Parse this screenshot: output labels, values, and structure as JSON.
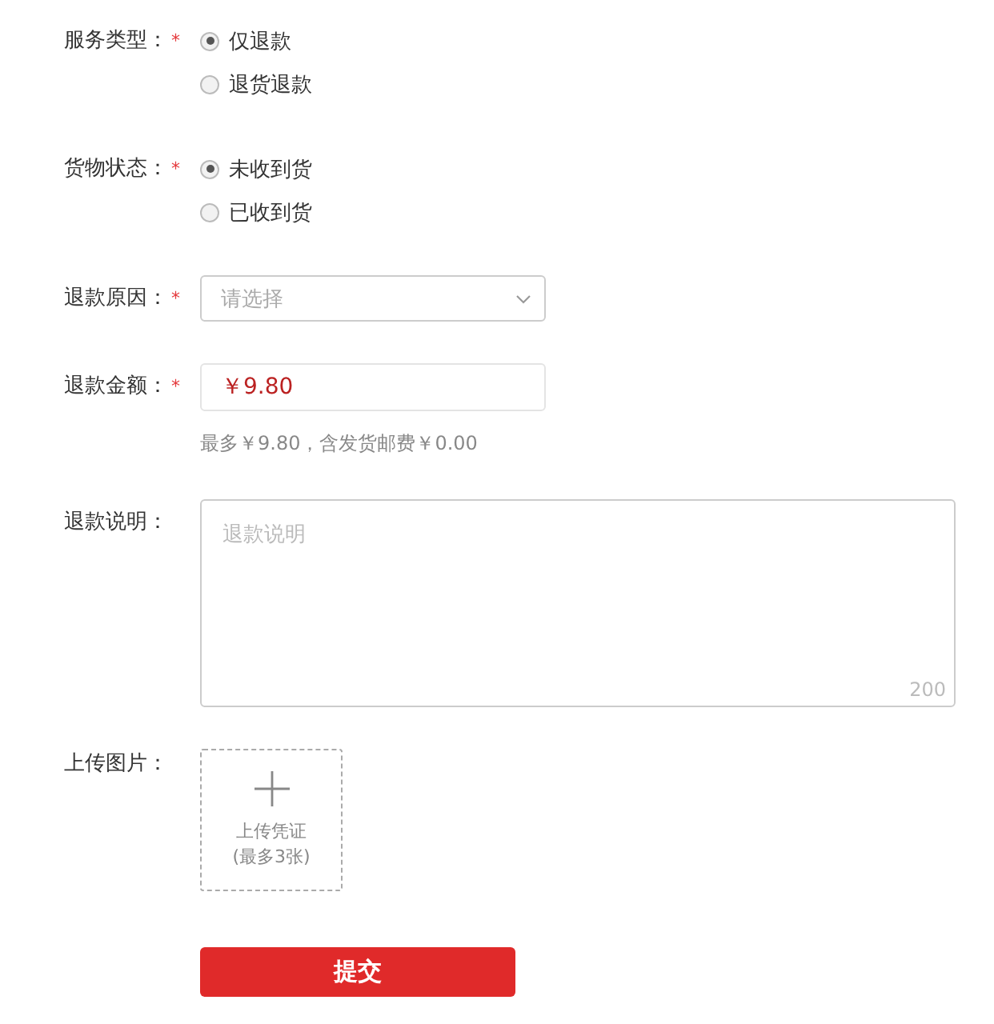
{
  "form": {
    "fields": [
      {
        "kind": "radio",
        "label": "服务类型：",
        "required_mark": "*",
        "options": [
          {
            "label": "仅退款",
            "selected": true
          },
          {
            "label": "退货退款",
            "selected": false
          }
        ]
      },
      {
        "kind": "radio",
        "label": "货物状态：",
        "required_mark": "*",
        "options": [
          {
            "label": "未收到货",
            "selected": true
          },
          {
            "label": "已收到货",
            "selected": false
          }
        ]
      },
      {
        "kind": "select",
        "label": "退款原因：",
        "required_mark": "*",
        "placeholder": "请选择"
      },
      {
        "kind": "amount",
        "label": "退款金额：",
        "required_mark": "*",
        "value": "￥9.80",
        "hint": "最多￥9.80，含发货邮费￥0.00"
      },
      {
        "kind": "textarea",
        "label": "退款说明：",
        "placeholder": "退款说明",
        "counter": "200"
      },
      {
        "kind": "upload",
        "label": "上传图片：",
        "upload_label": "上传凭证",
        "upload_note": "(最多3张)"
      }
    ],
    "submit": "提交"
  }
}
